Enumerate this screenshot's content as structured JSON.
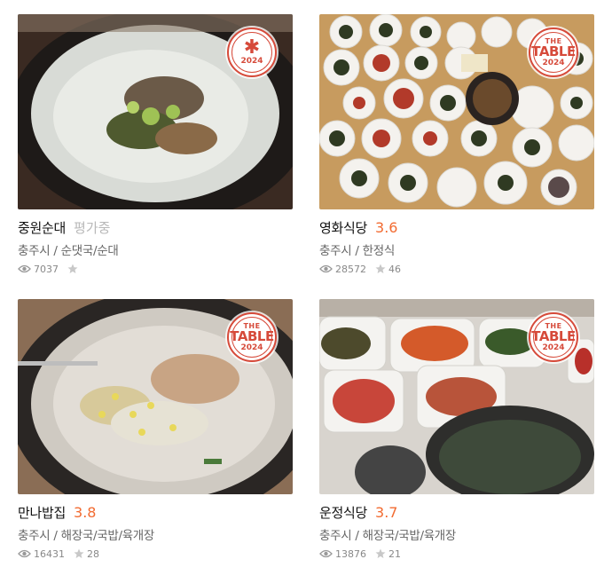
{
  "colors": {
    "accent": "#f26b31",
    "badge": "#d64a3a",
    "pending": "#b8b8b8"
  },
  "badge_text": {
    "the": "THE",
    "table": "TABLE",
    "year": "2024",
    "star": "✱"
  },
  "restaurants": [
    {
      "name": "중원순대",
      "score": "평가중",
      "score_pending": true,
      "location": "충주시",
      "category": "순댓국/순대",
      "meta": "충주시 / 순댓국/순대",
      "views": "7037",
      "favorites": "",
      "badge_type": "star"
    },
    {
      "name": "영화식당",
      "score": "3.6",
      "score_pending": false,
      "location": "충주시",
      "category": "한정식",
      "meta": "충주시 / 한정식",
      "views": "28572",
      "favorites": "46",
      "badge_type": "table"
    },
    {
      "name": "만나밥집",
      "score": "3.8",
      "score_pending": false,
      "location": "충주시",
      "category": "해장국/국밥/육개장",
      "meta": "충주시 / 해장국/국밥/육개장",
      "views": "16431",
      "favorites": "28",
      "badge_type": "table"
    },
    {
      "name": "운정식당",
      "score": "3.7",
      "score_pending": false,
      "location": "충주시",
      "category": "해장국/국밥/육개장",
      "meta": "충주시 / 해장국/국밥/육개장",
      "views": "13876",
      "favorites": "21",
      "badge_type": "table"
    }
  ]
}
